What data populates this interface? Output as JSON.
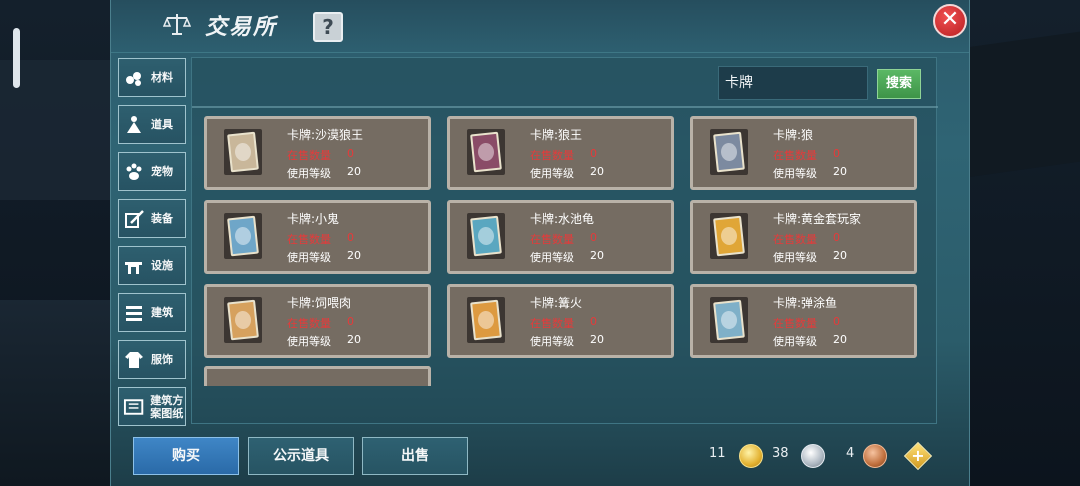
{
  "window": {
    "title": "交易所",
    "help_label": "?",
    "close_label": "✕"
  },
  "categories": [
    {
      "label": "材料",
      "icon": "materials-icon"
    },
    {
      "label": "道具",
      "icon": "item-icon"
    },
    {
      "label": "宠物",
      "icon": "paw-icon"
    },
    {
      "label": "装备",
      "icon": "equipment-icon"
    },
    {
      "label": "设施",
      "icon": "facility-icon"
    },
    {
      "label": "建筑",
      "icon": "building-icon"
    },
    {
      "label": "服饰",
      "icon": "clothing-icon"
    },
    {
      "label": "建筑方案图纸",
      "icon": "blueprint-icon"
    }
  ],
  "search": {
    "value": "卡牌",
    "button_label": "搜索"
  },
  "item_labels": {
    "stock": "在售数量",
    "level": "使用等级"
  },
  "items": [
    {
      "name": "卡牌:沙漠狼王",
      "stock": "0",
      "level": "20",
      "color": "#c9b79a"
    },
    {
      "name": "卡牌:狼王",
      "stock": "0",
      "level": "20",
      "color": "#8a4c67"
    },
    {
      "name": "卡牌:狼",
      "stock": "0",
      "level": "20",
      "color": "#7c8aa0"
    },
    {
      "name": "卡牌:小鬼",
      "stock": "0",
      "level": "20",
      "color": "#6fa6c8"
    },
    {
      "name": "卡牌:水池龟",
      "stock": "0",
      "level": "20",
      "color": "#5aa7c0"
    },
    {
      "name": "卡牌:黄金套玩家",
      "stock": "0",
      "level": "20",
      "color": "#e0a637"
    },
    {
      "name": "卡牌:饲喂肉",
      "stock": "0",
      "level": "20",
      "color": "#d6a15e"
    },
    {
      "name": "卡牌:篝火",
      "stock": "0",
      "level": "20",
      "color": "#dd9a40"
    },
    {
      "name": "卡牌:弹涂鱼",
      "stock": "0",
      "level": "20",
      "color": "#7fb0c8"
    }
  ],
  "bottom_buttons": {
    "buy": "购买",
    "public": "公示道具",
    "sell": "出售"
  },
  "currency": {
    "gold": "11",
    "silver": "38",
    "copper": "4",
    "add_label": "+"
  }
}
